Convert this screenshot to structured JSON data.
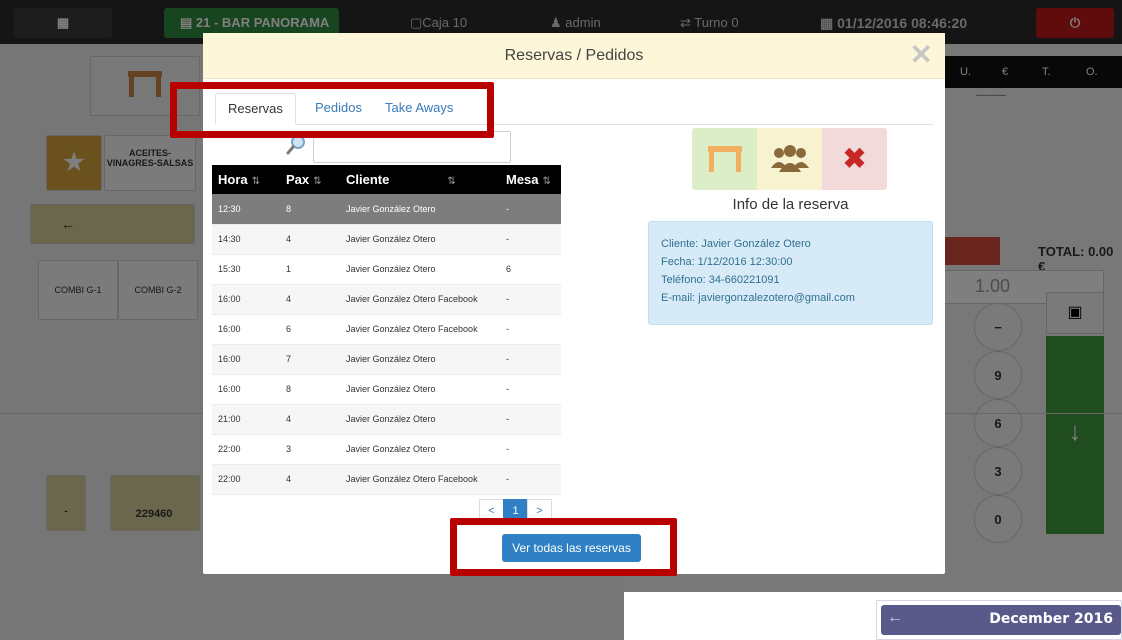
{
  "topbar": {
    "table_label": "21 - BAR PANORAMA",
    "caja": "Caja 10",
    "user": "admin",
    "turno": "Turno 0",
    "datetime": "01/12/2016 08:46:20"
  },
  "background": {
    "category_label": "ACEITES-VINAGRES-SALSAS",
    "product_1": "COMBI G-1",
    "product_2": "COMBI G-2",
    "ticket_number": "229460",
    "ticket_placeholder": "-",
    "columns": [
      "U.",
      "€",
      "T.",
      "O."
    ],
    "dashes": "----------",
    "total_label": "TOTAL: 0.00 €",
    "quantity": "1.00",
    "keys": [
      "9",
      "6",
      "3",
      "0"
    ],
    "calendar_title": "December 2016"
  },
  "modal": {
    "title": "Reservas / Pedidos",
    "tabs": [
      "Reservas",
      "Pedidos",
      "Take Aways"
    ],
    "search_placeholder": "",
    "table": {
      "headers": [
        "Hora",
        "Pax",
        "Cliente",
        "Mesa"
      ],
      "rows": [
        {
          "hora": "12:30",
          "pax": "8",
          "cliente": "Javier González Otero",
          "mesa": "-"
        },
        {
          "hora": "14:30",
          "pax": "4",
          "cliente": "Javier González Otero",
          "mesa": "-"
        },
        {
          "hora": "15:30",
          "pax": "1",
          "cliente": "Javier González Otero",
          "mesa": "6"
        },
        {
          "hora": "16:00",
          "pax": "4",
          "cliente": "Javier González Otero Facebook",
          "mesa": "-"
        },
        {
          "hora": "16:00",
          "pax": "6",
          "cliente": "Javier González Otero Facebook",
          "mesa": "-"
        },
        {
          "hora": "16:00",
          "pax": "7",
          "cliente": "Javier González Otero",
          "mesa": "-"
        },
        {
          "hora": "16:00",
          "pax": "8",
          "cliente": "Javier González Otero",
          "mesa": "-"
        },
        {
          "hora": "21:00",
          "pax": "4",
          "cliente": "Javier González Otero",
          "mesa": "-"
        },
        {
          "hora": "22:00",
          "pax": "3",
          "cliente": "Javier González Otero",
          "mesa": "-"
        },
        {
          "hora": "22:00",
          "pax": "4",
          "cliente": "Javier González Otero Facebook",
          "mesa": "-"
        }
      ]
    },
    "pagination": {
      "prev": "<",
      "current": "1",
      "next": ">"
    },
    "all_button": "Ver todas las reservas",
    "info": {
      "title": "Info de la reserva",
      "cliente": "Cliente: Javier González Otero",
      "fecha": "Fecha: 1/12/2016 12:30:00",
      "telefono": "Teléfono: 34-660221091",
      "email": "E-mail: javiergonzalezotero@gmail.com"
    },
    "icons": {
      "table": "table-icon",
      "people": "people-icon",
      "cancel": "close-icon",
      "search": "search-icon"
    }
  },
  "colors": {
    "highlight": "#b80000",
    "header_bg": "#fdf6d9",
    "primary": "#2f80c4"
  }
}
